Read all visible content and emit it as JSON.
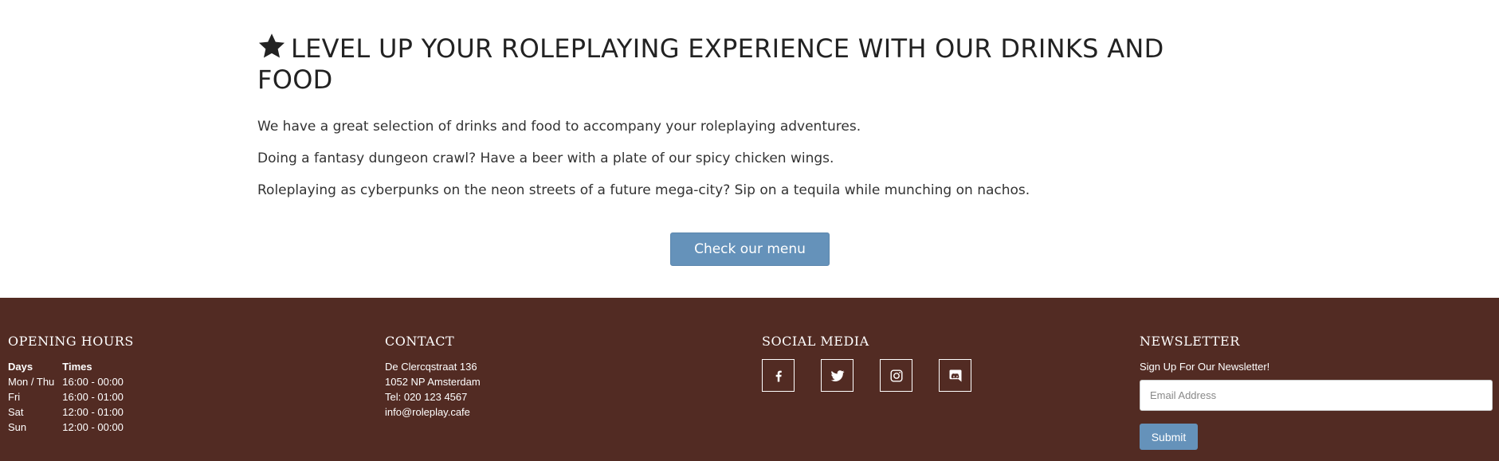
{
  "hero": {
    "title": "LEVEL UP YOUR ROLEPLAYING EXPERIENCE WITH OUR DRINKS AND FOOD",
    "icon": "star-icon",
    "paragraphs": [
      "We have a great selection of drinks and food to accompany your roleplaying adventures.",
      "Doing a fantasy dungeon crawl? Have a beer with a plate of our spicy chicken wings.",
      "Roleplaying as cyberpunks on the neon streets of a future mega-city? Sip on a tequila while munching on nachos."
    ],
    "button_label": "Check our menu"
  },
  "footer": {
    "background_color": "#522b23",
    "accent_color": "#6592ba",
    "hours": {
      "title": "OPENING HOURS",
      "headers": [
        "Days",
        "Times"
      ],
      "rows": [
        [
          "Mon / Thu",
          "16:00 - 00:00"
        ],
        [
          "Fri",
          "16:00 - 01:00"
        ],
        [
          "Sat",
          "12:00 - 01:00"
        ],
        [
          "Sun",
          "12:00 - 00:00"
        ]
      ]
    },
    "contact": {
      "title": "CONTACT",
      "lines": [
        "De Clercqstraat 136",
        "1052 NP Amsterdam",
        "Tel: 020 123 4567",
        "info@roleplay.cafe"
      ]
    },
    "social": {
      "title": "SOCIAL MEDIA",
      "icons": [
        "facebook-icon",
        "twitter-icon",
        "instagram-icon",
        "discord-icon"
      ]
    },
    "newsletter": {
      "title": "NEWSLETTER",
      "label": "Sign Up For Our Newsletter!",
      "placeholder": "Email Address",
      "submit_label": "Submit"
    }
  }
}
